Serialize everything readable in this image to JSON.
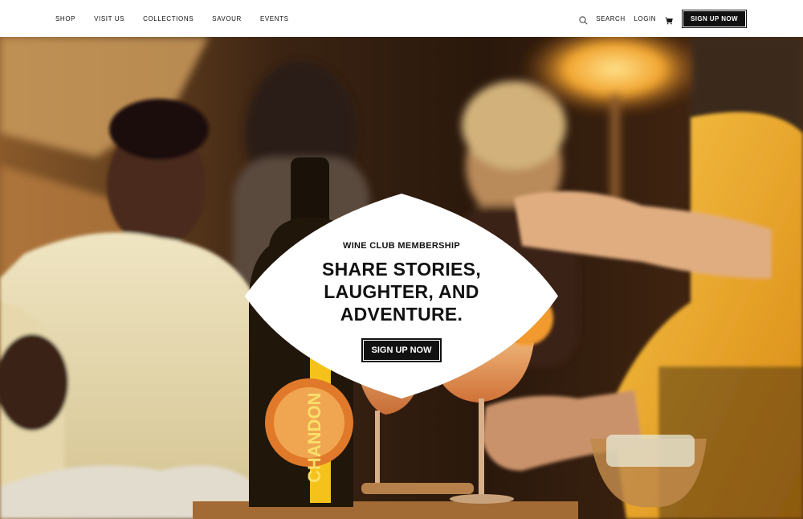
{
  "header": {
    "nav": [
      "SHOP",
      "VISIT US",
      "COLLECTIONS",
      "SAVOUR",
      "EVENTS"
    ],
    "search_label": "SEARCH",
    "login_label": "LOGIN",
    "signup_label": "SIGN UP NOW",
    "icons": {
      "search": "search-icon",
      "cart": "cart-icon"
    }
  },
  "hero": {
    "eyebrow": "WINE CLUB MEMBERSHIP",
    "headline": [
      "SHARE STORIES,",
      "LAUGHTER, AND",
      "ADVENTURE."
    ],
    "cta_label": "SIGN UP NOW",
    "bottle_label": "CHANDON"
  },
  "colors": {
    "accent": "#111111",
    "warm": "#e0902a",
    "yellow": "#f2b81e"
  }
}
